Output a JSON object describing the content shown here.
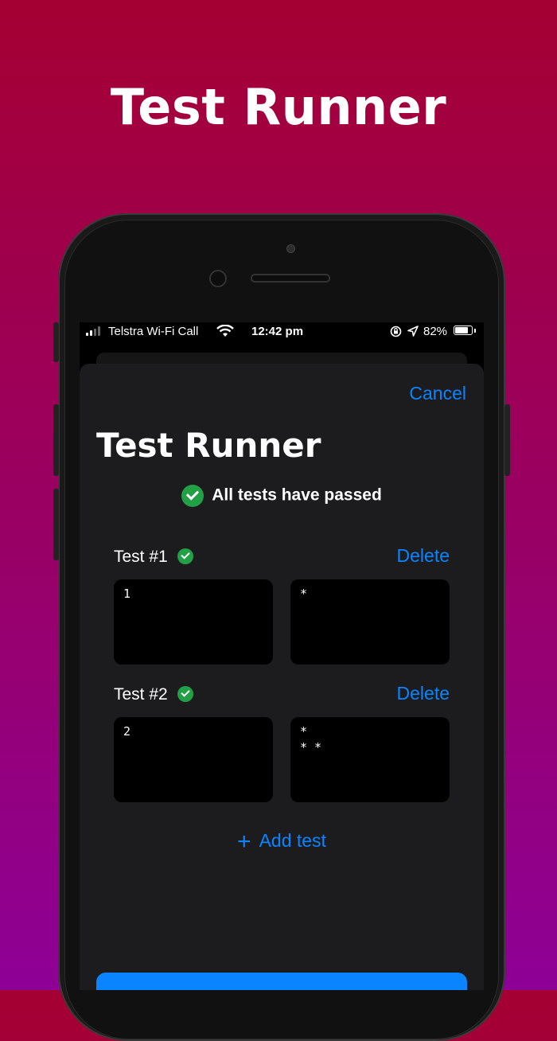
{
  "headline": "Test Runner",
  "status_bar": {
    "carrier": "Telstra Wi-Fi Call",
    "time": "12:42 pm",
    "battery": "82%",
    "battery_level": 0.82
  },
  "sheet": {
    "cancel_label": "Cancel",
    "title": "Test Runner",
    "status_message": "All tests have passed",
    "tests": [
      {
        "label": "Test #1",
        "delete_label": "Delete",
        "input": "1",
        "output": "*"
      },
      {
        "label": "Test #2",
        "delete_label": "Delete",
        "input": "2",
        "output": "*\n* *"
      }
    ],
    "add_test_label": "Add test",
    "add_test_icon": "+"
  },
  "colors": {
    "accent": "#0a84ff",
    "success": "#22a046",
    "sheet_bg": "#1c1c1e"
  }
}
